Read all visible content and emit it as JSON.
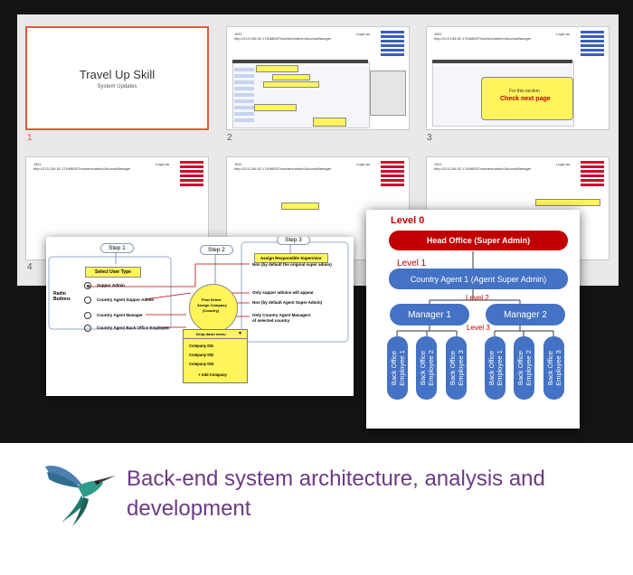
{
  "slide_sorter": {
    "slides": [
      {
        "number": "1",
        "title": "Travel Up Skill",
        "subtitle": "System Updates"
      },
      {
        "number": "2"
      },
      {
        "number": "3",
        "callout": "For this section",
        "callout_2": "Check next page"
      },
      {
        "number": "4"
      }
    ],
    "header_ref": "1811",
    "header_url": "http://213.136.92.178:8883/Travelers/admin/AccessManager",
    "login": "Login as"
  },
  "flow_slide": {
    "step1": "Step 1",
    "step2": "Step 2",
    "step3": "Step 3",
    "select_user_type": "Select User Type",
    "assign_supervisor": "Assign Responsible Supervisor",
    "radio_label": "Radio Buttons",
    "options": [
      "Suppor Admin",
      "Country Agent Suppor Admin",
      "Country Agent Manager",
      "Country Agent Back Office Employee"
    ],
    "notes": [
      "Non (by default the original super admin)",
      "Only supper admins will appear",
      "Non (by default Agent Super Admin)",
      "Only Country Agent Managers",
      "of selected country"
    ],
    "first_select": [
      "First Select",
      "Assign Company",
      "(Country)"
    ],
    "dropdown_label": "Drop down menu",
    "companies": [
      "Company 001",
      "Company 002",
      "Company 003"
    ],
    "add_company": "+ Add Company"
  },
  "org_chart": {
    "level0": "Level 0",
    "head_office": "Head Office (Super Admin)",
    "level1": "Level 1",
    "country_agent": "Country Agent 1 (Agent Super Admin)",
    "level2": "Level 2",
    "manager1": "Manager 1",
    "manager2": "Manager 2",
    "level3": "Level 3",
    "employees": [
      "Back Office\nEmployee 1",
      "Back Office\nEmployee 2",
      "Back Office\nEmployee 3",
      "Back Office\nEmployee 1",
      "Back Office\nEmployee 2",
      "Back Office\nEmployee 3"
    ]
  },
  "caption": "Back-end system architecture, analysis and development",
  "colors": {
    "caption": "#6b3a86",
    "org_blue": "#4472c4",
    "head_red": "#c00000",
    "yellow": "#fff45a"
  }
}
